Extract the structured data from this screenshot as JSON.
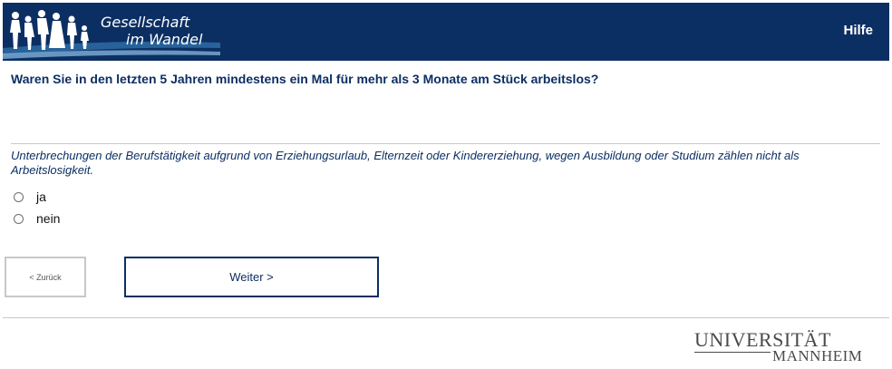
{
  "header": {
    "logo_line1": "Gesellschaft",
    "logo_line2": "im Wandel",
    "help_label": "Hilfe",
    "brand_color": "#0c2f63"
  },
  "question": {
    "text": "Waren Sie in den letzten 5 Jahren mindestens ein Mal für mehr als 3 Monate am Stück arbeitslos?",
    "instruction": "Unterbrechungen der Berufstätigkeit aufgrund von Erziehungsurlaub, Elternzeit oder Kindererziehung, wegen Ausbildung oder Studium zählen nicht als Arbeitslosigkeit."
  },
  "options": [
    {
      "label": "ja",
      "selected": false
    },
    {
      "label": "nein",
      "selected": false
    }
  ],
  "navigation": {
    "back_label": "< Zurück",
    "next_label": "Weiter >"
  },
  "footer": {
    "university_line1": "UNIVERSITÄT",
    "university_line2": "MANNHEIM"
  }
}
